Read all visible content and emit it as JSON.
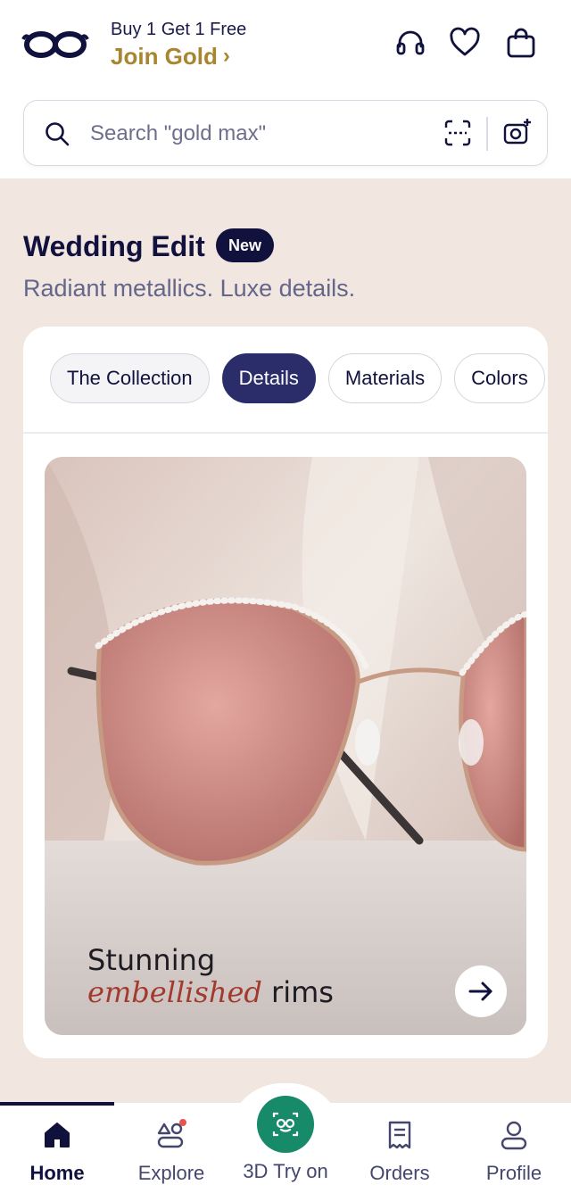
{
  "header": {
    "promo_line1": "Buy 1 Get 1 Free",
    "promo_line2": "Join Gold",
    "promo_chevron": "›",
    "accent_color": "#a8862f",
    "icons": [
      "headset-icon",
      "heart-icon",
      "bag-icon"
    ]
  },
  "search": {
    "placeholder": "Search \"gold max\"",
    "icons": [
      "search-icon",
      "scan-icon",
      "camera-icon"
    ]
  },
  "section": {
    "title": "Wedding Edit",
    "badge": "New",
    "subtitle": "Radiant metallics. Luxe details.",
    "tabs": [
      {
        "label": "The Collection",
        "active": false
      },
      {
        "label": "Details",
        "active": true
      },
      {
        "label": "Materials",
        "active": false
      },
      {
        "label": "Colors",
        "active": false
      }
    ],
    "hero": {
      "caption_line1": "Stunning",
      "caption_em": "embellished",
      "caption_rest": " rims",
      "arrow_icon": "arrow-right-icon"
    }
  },
  "nav": {
    "items": [
      {
        "label": "Home",
        "icon": "home-icon",
        "active": true
      },
      {
        "label": "Explore",
        "icon": "explore-icon",
        "active": false
      },
      {
        "label": "3D Try on",
        "icon": "glasses-face-icon",
        "active": false
      },
      {
        "label": "Orders",
        "icon": "orders-icon",
        "active": false
      },
      {
        "label": "Profile",
        "icon": "profile-icon",
        "active": false
      }
    ],
    "tryon_color": "#178a6a"
  }
}
